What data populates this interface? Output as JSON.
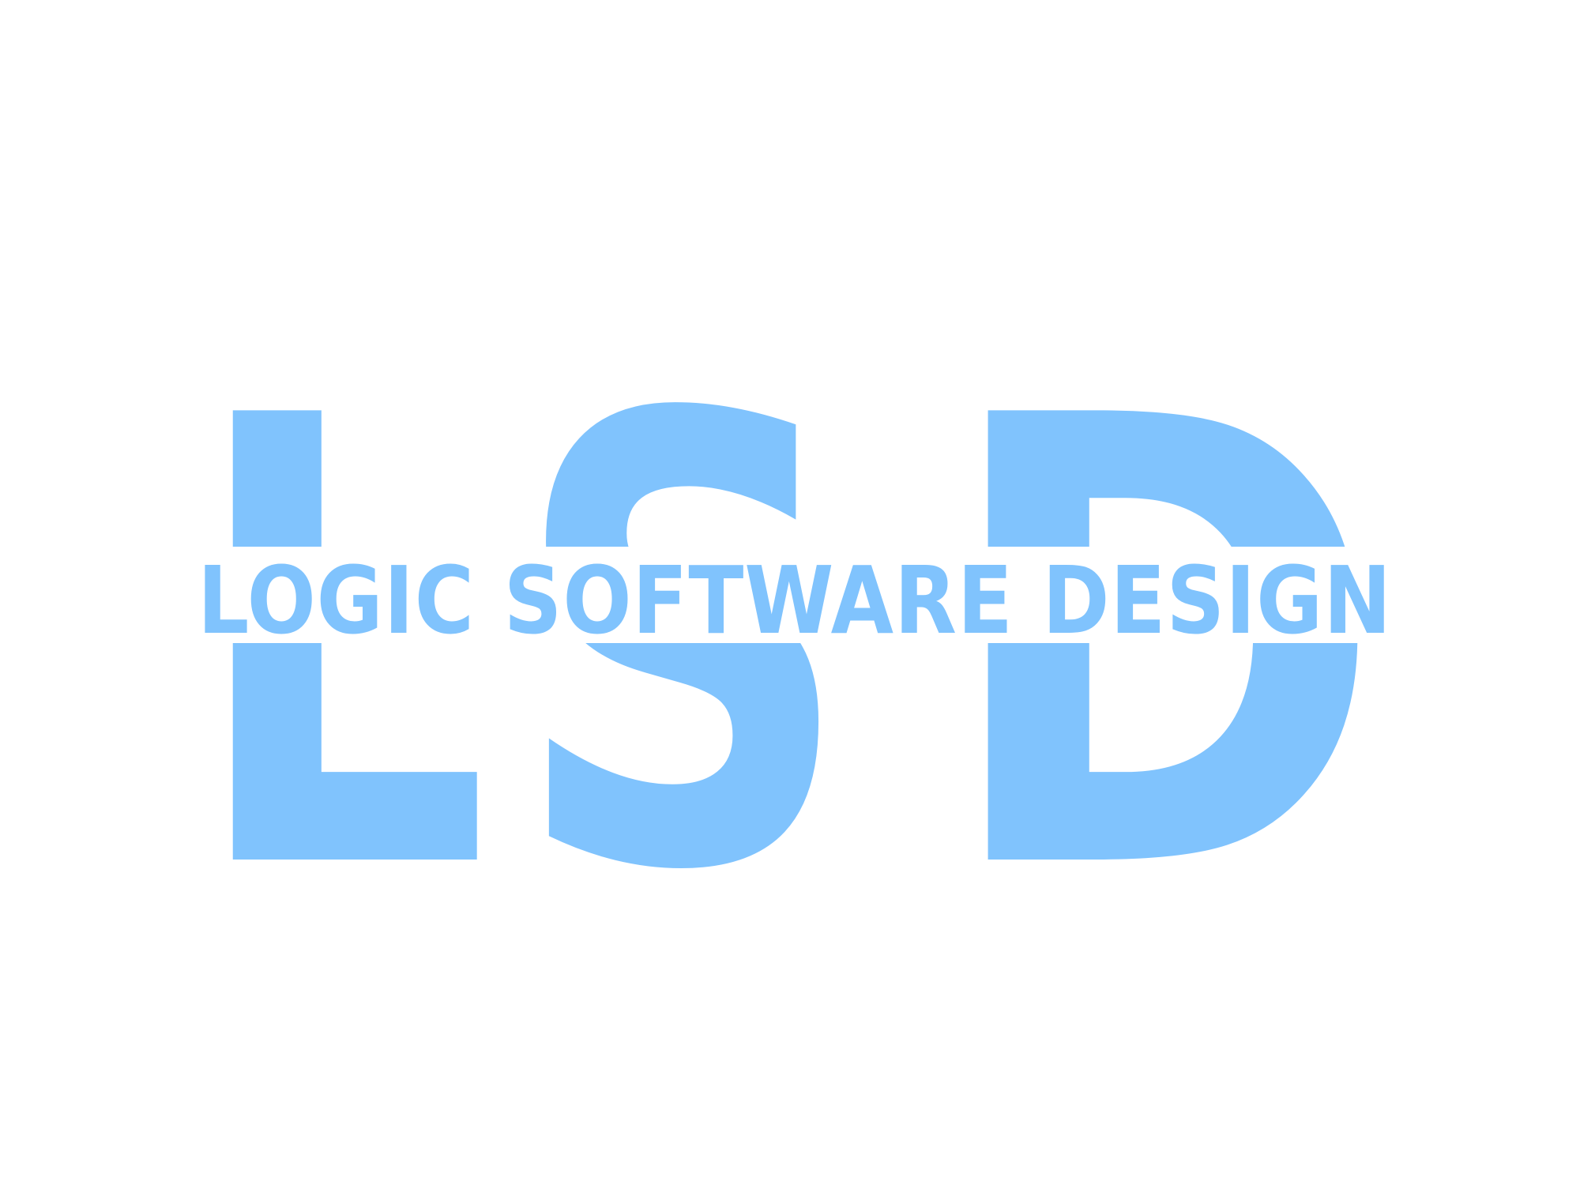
{
  "logo": {
    "monogram": {
      "l": "L",
      "s": "S",
      "d": "D"
    },
    "tagline": "LOGIC SOFTWARE DESIGN",
    "colors": {
      "brand": "#80c3fd",
      "background": "#ffffff"
    }
  }
}
